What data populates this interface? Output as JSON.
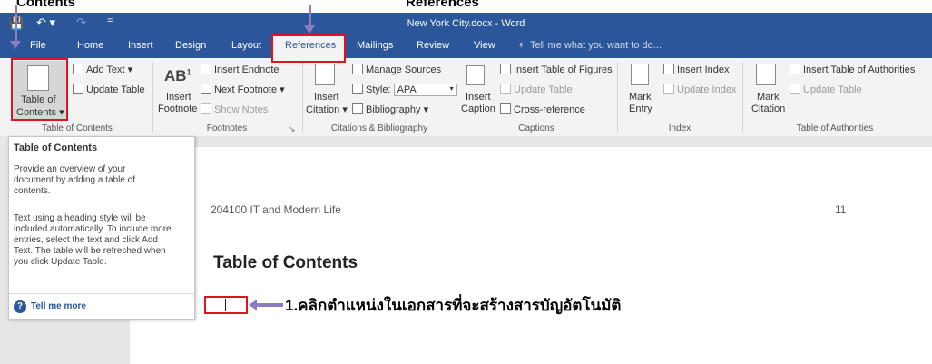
{
  "annotations": {
    "top_left": "Contents",
    "top_mid": "References",
    "step1": "1.คลิกตำแหน่งในเอกสารที่จะสร้างสารบัญอัตโนมัติ"
  },
  "titlebar": {
    "title": "New York City.docx - Word"
  },
  "tabs": [
    "File",
    "Home",
    "Insert",
    "Design",
    "Layout",
    "References",
    "Mailings",
    "Review",
    "View"
  ],
  "tell_me": "Tell me what you want to do...",
  "ribbon": {
    "toc": {
      "btn1": "Table of",
      "btn2": "Contents ▾",
      "add_text": "Add Text ▾",
      "update_table": "Update Table",
      "group": "Table of Contents"
    },
    "footnotes": {
      "ab": "AB",
      "sup": "1",
      "insert1": "Insert",
      "insert2": "Footnote",
      "insert_endnote": "Insert Endnote",
      "next_footnote": "Next Footnote ▾",
      "show_notes": "Show Notes",
      "group": "Footnotes"
    },
    "citations": {
      "insert1": "Insert",
      "insert2": "Citation ▾",
      "manage_sources": "Manage Sources",
      "style_label": "Style:",
      "style_value": "APA",
      "bibliography": "Bibliography ▾",
      "group": "Citations & Bibliography"
    },
    "captions": {
      "insert1": "Insert",
      "insert2": "Caption",
      "insert_tof": "Insert Table of Figures",
      "update_table": "Update Table",
      "cross_ref": "Cross-reference",
      "group": "Captions"
    },
    "index": {
      "mark1": "Mark",
      "mark2": "Entry",
      "insert_index": "Insert Index",
      "update_index": "Update Index",
      "group": "Index"
    },
    "toa": {
      "mark1": "Mark",
      "mark2": "Citation",
      "insert_toa": "Insert Table of Authorities",
      "update_table": "Update Table",
      "group": "Table of Authorities"
    }
  },
  "tooltip": {
    "title": "Table of Contents",
    "p1": "Provide an overview of your document by adding a table of contents.",
    "p2": "Text using a heading style will be included automatically. To include more entries, select the text and click Add Text. The table will be refreshed when you click Update Table.",
    "link": "Tell me more"
  },
  "document": {
    "header_left": "204100 IT and Modern Life",
    "header_right": "11",
    "heading": "Table of Contents"
  },
  "colors": {
    "word_blue": "#2b579a",
    "annotation_red": "#e0141e",
    "annotation_purple": "#8e7cc3"
  }
}
